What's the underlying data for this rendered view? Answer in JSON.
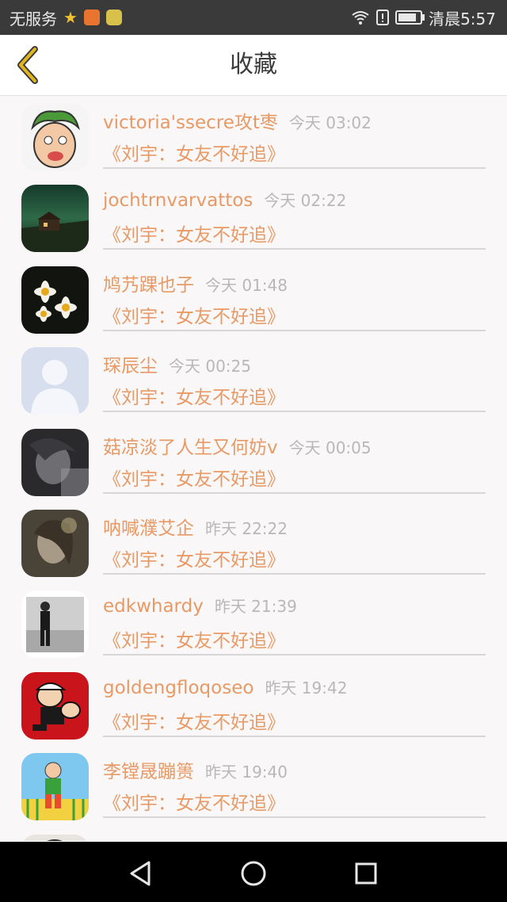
{
  "status_bar": {
    "carrier": "无服务",
    "time": "清晨5:57",
    "battery_level": 0.85
  },
  "header": {
    "title": "收藏",
    "back_icon": "chevron-left-icon",
    "accent_color": "#e0b51e"
  },
  "items": [
    {
      "name": "victoria'ssecre攻t枣",
      "time": "今天 03:02",
      "book": "《刘宇：女友不好追》"
    },
    {
      "name": "jochtrnvarvattos",
      "time": "今天 02:22",
      "book": "《刘宇：女友不好追》"
    },
    {
      "name": "鸠艿踝也子",
      "time": "今天 01:48",
      "book": "《刘宇：女友不好追》"
    },
    {
      "name": "琛辰尘",
      "time": "今天 00:25",
      "book": "《刘宇：女友不好追》"
    },
    {
      "name": "菇凉淡了人生又何妨v",
      "time": "今天 00:05",
      "book": "《刘宇：女友不好追》"
    },
    {
      "name": "呐喊濮艾企",
      "time": "昨天 22:22",
      "book": "《刘宇：女友不好追》"
    },
    {
      "name": "edkwhardy",
      "time": "昨天 21:39",
      "book": "《刘宇：女友不好追》"
    },
    {
      "name": "goldengfloqoseo",
      "time": "昨天 19:42",
      "book": "《刘宇：女友不好追》"
    },
    {
      "name": "李镗晟蹦篑",
      "time": "昨天 19:40",
      "book": "《刘宇：女友不好追》"
    }
  ],
  "nav_bar": {
    "back": "back-triangle-icon",
    "home": "home-circle-icon",
    "recents": "recents-square-icon"
  }
}
